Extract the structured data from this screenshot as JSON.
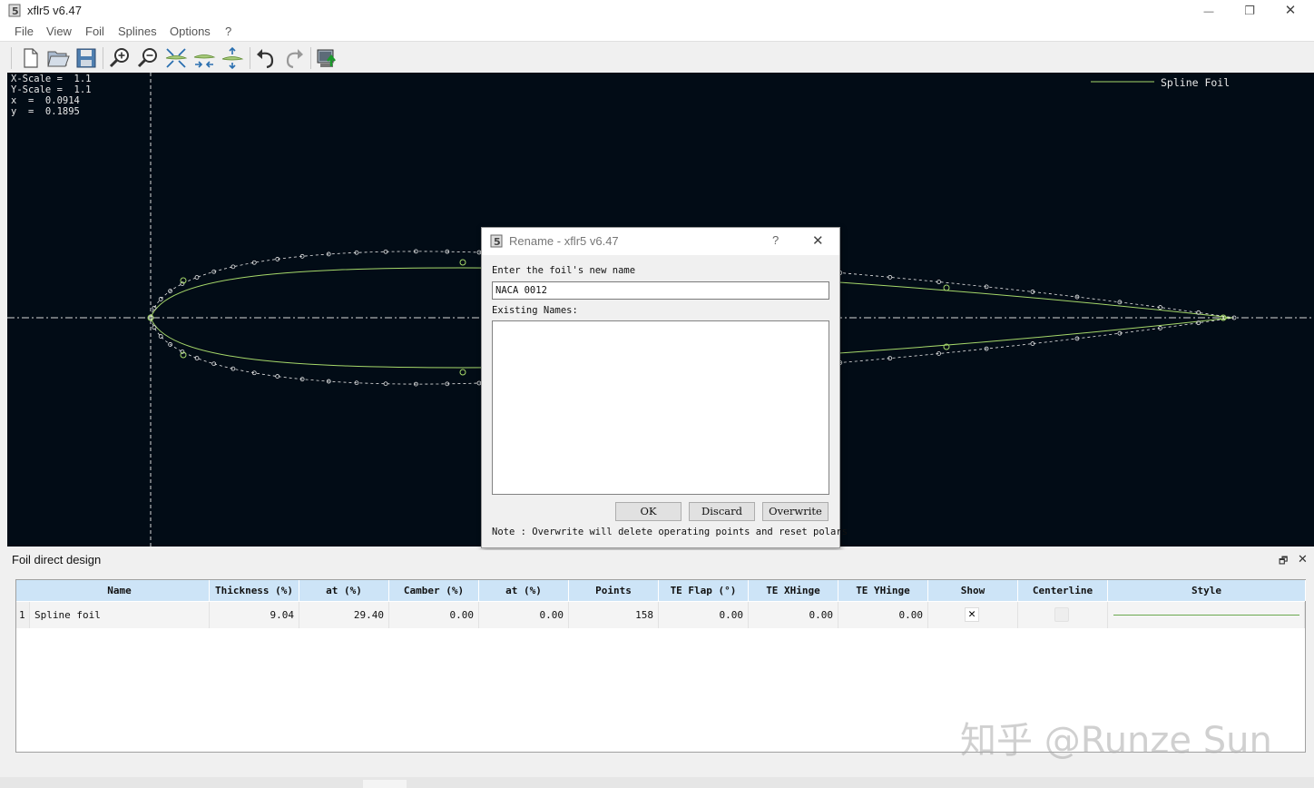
{
  "window": {
    "title": "xflr5 v6.47",
    "minimize_glyph": "—",
    "restore_glyph": "❐",
    "close_glyph": "✕"
  },
  "menu": [
    "File",
    "View",
    "Foil",
    "Splines",
    "Options",
    "?"
  ],
  "toolbar": {
    "icons": [
      "new-document-icon",
      "open-folder-icon",
      "save-icon",
      "zoom-in-icon",
      "zoom-out-icon",
      "reset-scale-icon",
      "x-scale-icon",
      "y-scale-icon",
      "undo-icon",
      "redo-icon",
      "export-icon"
    ]
  },
  "canvas": {
    "x_scale": "X-Scale =  1.1",
    "y_scale": "Y-Scale =  1.1",
    "x_value": "x  =  0.0914",
    "y_value": "y  =  0.1895",
    "legend_label": "Spline Foil",
    "colors": {
      "background": "#020c16",
      "foil_line": "#a6d86a",
      "points": "#e8e8e8",
      "control_points": "#a6d86a",
      "axes": "#d8d8d8"
    }
  },
  "dialog": {
    "title": "Rename - xflr5 v6.47",
    "help_glyph": "?",
    "close_glyph": "✕",
    "prompt_label": "Enter the foil's new name",
    "name_value": "NACA 0012",
    "existing_label": "Existing Names:",
    "existing_names": [],
    "ok_label": "OK",
    "discard_label": "Discard",
    "overwrite_label": "Overwrite",
    "note": "Note : Overwrite will delete operating points and reset polars"
  },
  "dock": {
    "title": "Foil direct design",
    "float_glyph": "🗗",
    "close_glyph": "✕",
    "columns": [
      "Name",
      "Thickness (%)",
      "at (%)",
      "Camber (%)",
      "at (%)",
      "Points",
      "TE Flap (°)",
      "TE XHinge",
      "TE YHinge",
      "Show",
      "Centerline",
      "Style"
    ],
    "rows": [
      {
        "index": "1",
        "name": "Spline foil",
        "thickness": "9.04",
        "thickness_at": "29.40",
        "camber": "0.00",
        "camber_at": "0.00",
        "points": "158",
        "te_flap": "0.00",
        "te_xhinge": "0.00",
        "te_yhinge": "0.00",
        "show_mark": "✕",
        "show": true,
        "centerline": false,
        "style_color": "#6aa84f"
      }
    ]
  },
  "watermark": "知乎 @Runze Sun"
}
